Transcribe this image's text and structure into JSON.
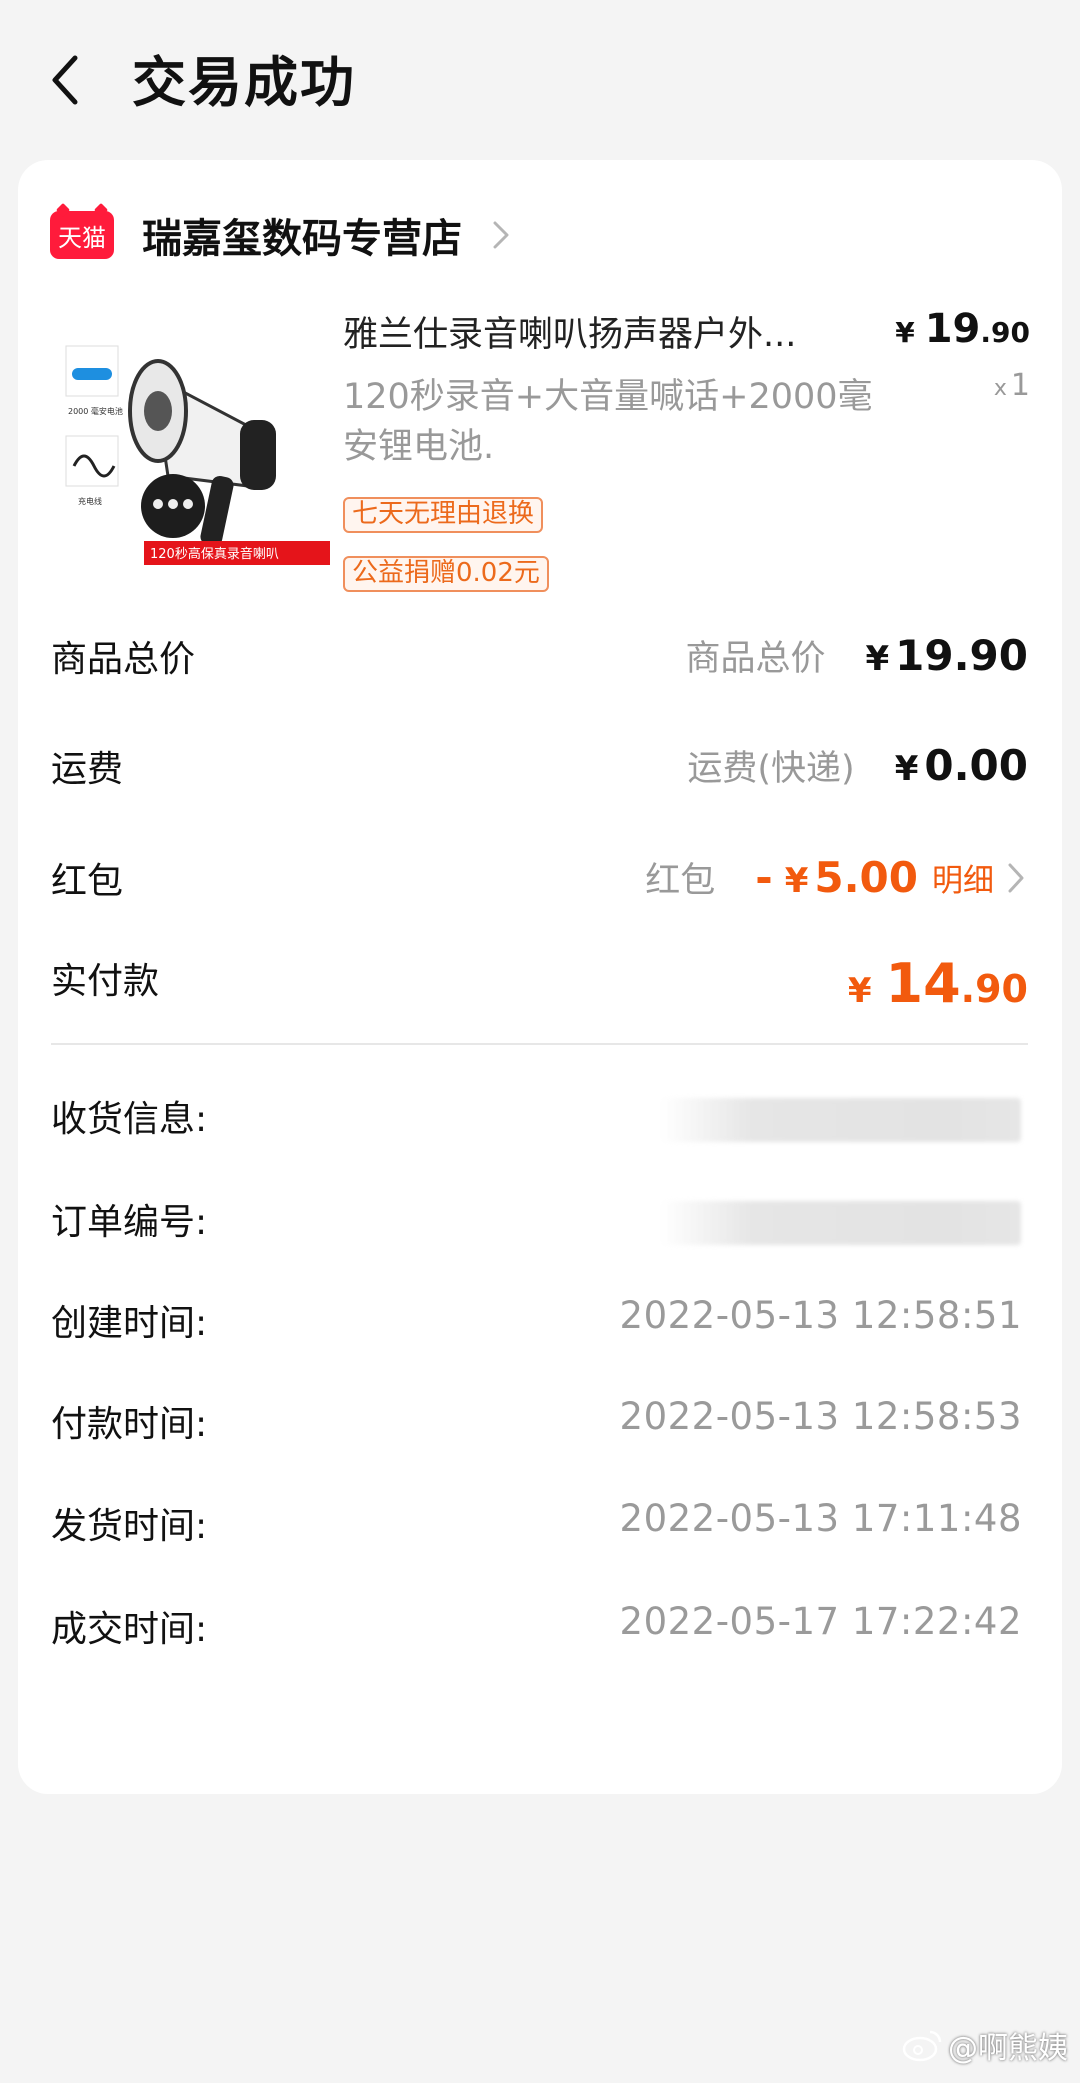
{
  "header": {
    "title": "交易成功"
  },
  "shop": {
    "badge": "天猫",
    "name": "瑞嘉玺数码专营店"
  },
  "product": {
    "title": "雅兰仕录音喇叭扬声器户外...",
    "desc": "120秒录音+大音量喊话+2000毫安锂电池.",
    "tags": [
      "七天无理由退换",
      "公益捐赠0.02元"
    ],
    "price_symbol": "¥",
    "price_int": "19",
    "price_dec": ".90",
    "qty_prefix": "x",
    "qty": "1",
    "image_labels": [
      "2000 毫安电池",
      "充电线",
      "120秒高保真录音喇叭"
    ]
  },
  "summary": {
    "goods": {
      "label": "商品总价",
      "sub_label": "商品总价",
      "symbol": "¥",
      "amount": "19.90"
    },
    "shipping": {
      "label": "运费",
      "sub_label": "运费(快递)",
      "symbol": "¥",
      "amount": "0.00"
    },
    "red_packet": {
      "label": "红包",
      "sub_label": "红包",
      "minus": "-",
      "symbol": "¥",
      "amount": "5.00",
      "detail": "明细"
    },
    "paid": {
      "label": "实付款",
      "symbol": "¥",
      "amount_int": "14",
      "amount_dec": ".90"
    }
  },
  "order_info": {
    "address_label": "收货信息:",
    "order_no_label": "订单编号:",
    "rows": [
      {
        "label": "创建时间:",
        "value": "2022-05-13 12:58:51"
      },
      {
        "label": "付款时间:",
        "value": "2022-05-13 12:58:53"
      },
      {
        "label": "发货时间:",
        "value": "2022-05-13 17:11:48"
      },
      {
        "label": "成交时间:",
        "value": "2022-05-17 17:22:42"
      }
    ]
  },
  "watermark": "@啊熊姨",
  "colors": {
    "accent": "#f25a0e",
    "tmall_red": "#ff1b3b",
    "tag_border": "#f08f5c"
  }
}
